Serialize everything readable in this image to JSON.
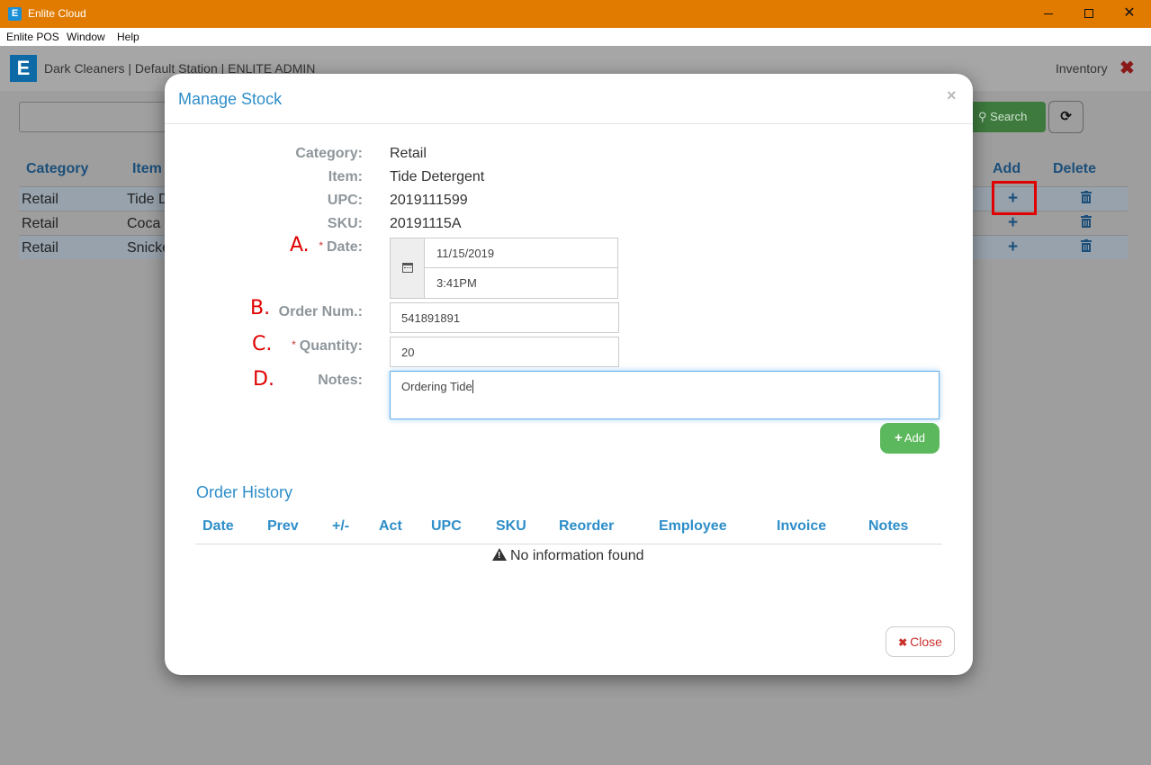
{
  "window": {
    "icon_letter": "E",
    "title": "Enlite Cloud",
    "menu": [
      "Enlite POS",
      "Window",
      "Help"
    ]
  },
  "app": {
    "logo_letter": "E",
    "header_title": "Dark Cleaners | Default Station | ENLITE ADMIN",
    "section": "Inventory",
    "search_button": "Search",
    "columns": [
      "Category",
      "Item",
      "Add",
      "Delete"
    ],
    "rows": [
      {
        "category": "Retail",
        "item": "Tide D"
      },
      {
        "category": "Retail",
        "item": "Coca"
      },
      {
        "category": "Retail",
        "item": "Snicke"
      }
    ],
    "add_icon": "+",
    "accent_color": "#1b4f7a",
    "highlight_color": "#e00000"
  },
  "modal": {
    "title": "Manage Stock",
    "close_x": "×",
    "labels": {
      "category": "Category:",
      "item": "Item:",
      "upc": "UPC:",
      "sku": "SKU:",
      "date": "Date:",
      "order_num": "Order Num.:",
      "quantity": "Quantity:",
      "notes": "Notes:"
    },
    "required_mark": "*",
    "values": {
      "category": "Retail",
      "item": "Tide Detergent",
      "upc": "2019111599",
      "sku": "20191115A"
    },
    "inputs": {
      "date": "11/15/2019",
      "time": "3:41PM",
      "order_num": "541891891",
      "quantity": "20",
      "notes": "Ordering Tide"
    },
    "annotations": {
      "a": "A.",
      "b": "B.",
      "c": "C.",
      "d": "D."
    },
    "add_button": "Add",
    "order_history": {
      "title": "Order History",
      "columns": [
        "Date",
        "Prev",
        "+/-",
        "Act",
        "UPC",
        "SKU",
        "Reorder",
        "Employee",
        "Invoice",
        "Notes"
      ],
      "empty_message": "No information found"
    },
    "close_button": "Close",
    "title_color": "#2e8ec9",
    "add_color": "#5cb85c"
  }
}
